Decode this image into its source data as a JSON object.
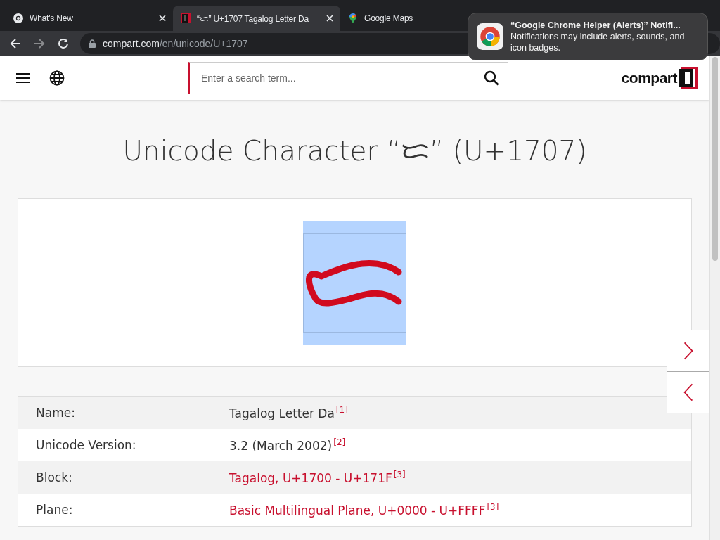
{
  "browser": {
    "tabs": [
      {
        "title": "What's New",
        "selected": false
      },
      {
        "title": "“ᜇ” U+1707 Tagalog Letter Da",
        "selected": true
      },
      {
        "title": "Google Maps",
        "selected": false
      }
    ],
    "url": {
      "domain": "compart.com",
      "path": "/en/unicode/U+1707"
    }
  },
  "notification": {
    "title": "“Google Chrome Helper (Alerts)” Notifi...",
    "body": "Notifications may include alerts, sounds, and icon badges."
  },
  "header": {
    "search": {
      "placeholder": "Enter a search term..."
    },
    "logo": "compart"
  },
  "page": {
    "title": "Unicode Character “ᜇ” (U+1707)",
    "properties": [
      {
        "label": "Name:",
        "value": "Tagalog Letter Da",
        "ref": "[1]",
        "link": false
      },
      {
        "label": "Unicode Version:",
        "value": "3.2 (March 2002)",
        "ref": "[2]",
        "link": false
      },
      {
        "label": "Block:",
        "value": "Tagalog, U+1700 - U+171F",
        "ref": "[3]",
        "link": true
      },
      {
        "label": "Plane:",
        "value": "Basic Multilingual Plane, U+0000 - U+FFFF",
        "ref": "[3]",
        "link": true
      }
    ]
  }
}
